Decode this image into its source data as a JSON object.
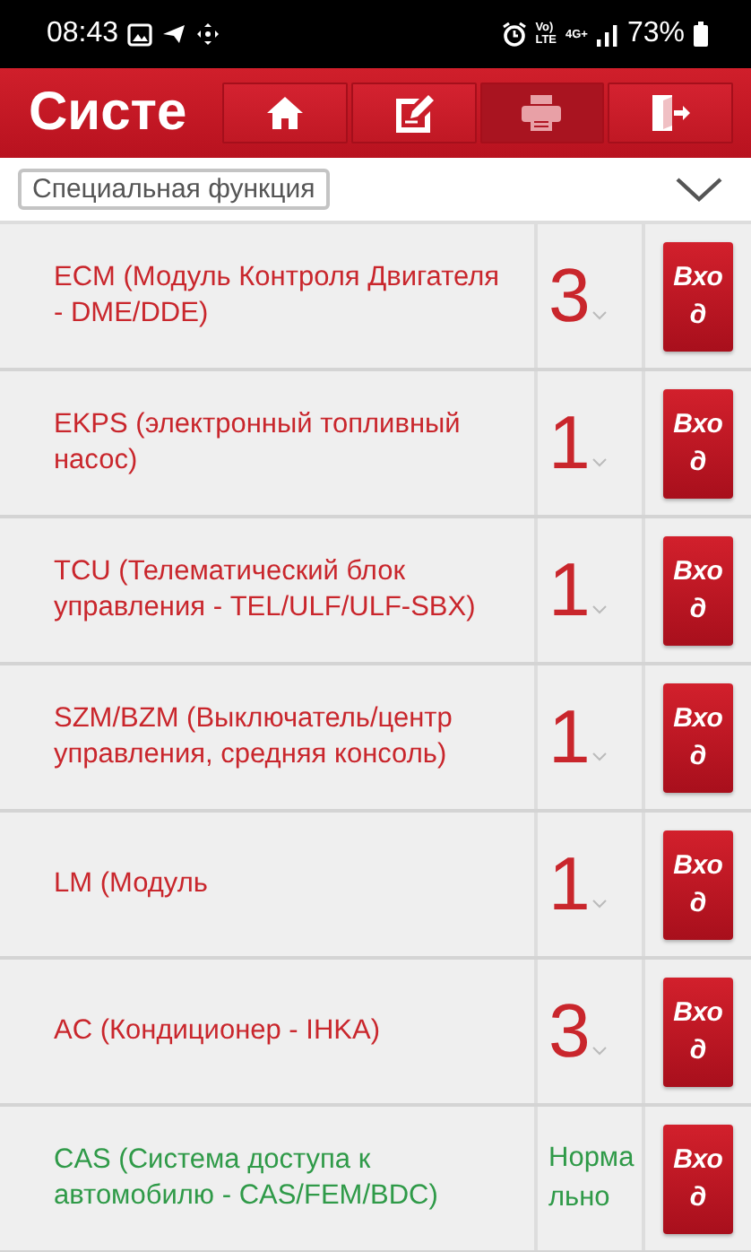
{
  "status_bar": {
    "time": "08:43",
    "volte": "Vo)",
    "lte": "LTE",
    "network": "4G+",
    "battery": "73%"
  },
  "header": {
    "title": "Систе",
    "buttons": [
      {
        "kind": "home",
        "disabled": false
      },
      {
        "kind": "edit",
        "disabled": false
      },
      {
        "kind": "print",
        "disabled": true
      },
      {
        "kind": "exit",
        "disabled": false
      }
    ]
  },
  "filter": {
    "value": "Специальная функция"
  },
  "systems": [
    {
      "name": "ECM (Модуль Контроля Двигателя - DME/DDE)",
      "kind": "count",
      "color": "#c9262c",
      "reading": "3",
      "button": "Вход"
    },
    {
      "name": "EKPS (электронный топливный насос)",
      "kind": "count",
      "color": "#c9262c",
      "reading": "1",
      "button": "Вход"
    },
    {
      "name": "TCU (Телематический блок управления - TEL/ULF/ULF-SBX)",
      "kind": "count",
      "color": "#c9262c",
      "reading": "1",
      "button": "Вход"
    },
    {
      "name": "SZM/BZM (Выключатель/центр управления, средняя консоль)",
      "kind": "count",
      "color": "#c9262c",
      "reading": "1",
      "button": "Вход"
    },
    {
      "name": "LM (Модуль",
      "kind": "count",
      "color": "#c9262c",
      "reading": "1",
      "button": "Вход"
    },
    {
      "name": "AC (Кондиционер - IHKA)",
      "kind": "count",
      "color": "#c9262c",
      "reading": "3",
      "button": "Вход"
    },
    {
      "name": "CAS (Система доступа к автомобилю - CAS/FEM/BDC)",
      "kind": "text",
      "color": "#2f9a48",
      "reading": "Нормально",
      "button": "Вход"
    }
  ]
}
